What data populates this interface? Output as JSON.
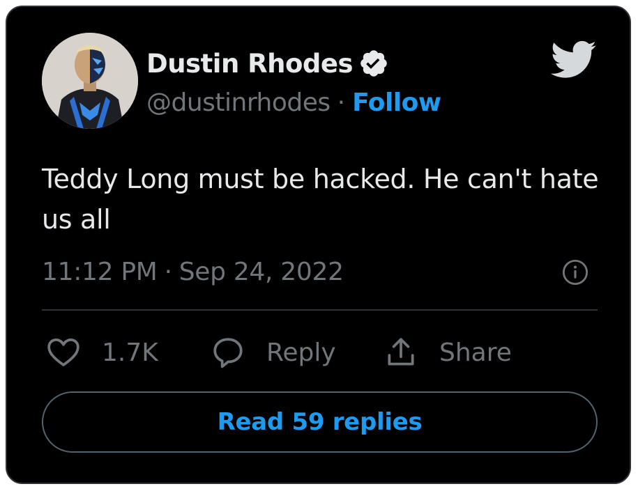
{
  "author": {
    "display_name": "Dustin Rhodes",
    "handle": "@dustinrhodes",
    "separator": "·",
    "follow_label": "Follow",
    "verified": true
  },
  "tweet": {
    "text": "Teddy Long must be hacked. He can't hate us all",
    "time": "11:12 PM",
    "time_separator": "·",
    "date": "Sep 24, 2022"
  },
  "actions": {
    "like_count": "1.7K",
    "reply_label": "Reply",
    "share_label": "Share"
  },
  "read_replies_label": "Read 59 replies",
  "icons": {
    "brand": "twitter-bird-icon",
    "verified": "verified-badge-icon",
    "info": "info-icon",
    "like": "heart-icon",
    "reply": "speech-bubble-icon",
    "share": "share-upload-icon"
  },
  "colors": {
    "background": "#000000",
    "text": "#e7e9ea",
    "muted": "#71767b",
    "accent": "#1d9bf0",
    "border": "#2f3336"
  }
}
